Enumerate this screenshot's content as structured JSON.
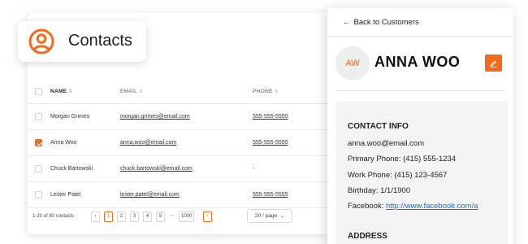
{
  "badge": {
    "title": "Contacts"
  },
  "table": {
    "headers": {
      "name": "NAME",
      "email": "EMAIL",
      "phone": "PHONE",
      "sort_glyph": "⇅"
    },
    "rows": [
      {
        "name": "Morgan Grimes",
        "email": "morgan.grimes@email.com",
        "phone": "555-555-5555",
        "checked": false
      },
      {
        "name": "Anna Woo",
        "email": "anna.woo@email.com",
        "phone": "555-555-5555",
        "checked": true
      },
      {
        "name": "Chuck Bartowski",
        "email": "chuck.bartowski@email.com",
        "phone": "-",
        "checked": false
      },
      {
        "name": "Lester Patel",
        "email": "lester.patel@email.com",
        "phone": "555-555-5555",
        "checked": false
      }
    ],
    "pager": {
      "info": "1-20 of 80 contacts",
      "prev": "‹",
      "pages": [
        "1",
        "2",
        "3",
        "4",
        "5"
      ],
      "ellipsis": "···",
      "last": "1000",
      "next": "›",
      "per_page": "20 / page",
      "per_page_caret": "⌄"
    }
  },
  "detail": {
    "back_arrow": "←",
    "back_label": "Back to Customers",
    "initials": "AW",
    "name": "ANNA WOO",
    "contact_info_title": "CONTACT INFO",
    "email": "anna.woo@email.com",
    "primary_phone": "Primary Phone: (415) 555-1234",
    "work_phone": "Work Phone: (415) 123-4567",
    "birthday": "Birthday: 1/1/1900",
    "facebook_label": "Facebook: ",
    "facebook_url": "http://www.facebook.com/a",
    "address_title": "ADDRESS"
  },
  "colors": {
    "accent": "#f26a1b",
    "link": "#1a6fd1"
  }
}
